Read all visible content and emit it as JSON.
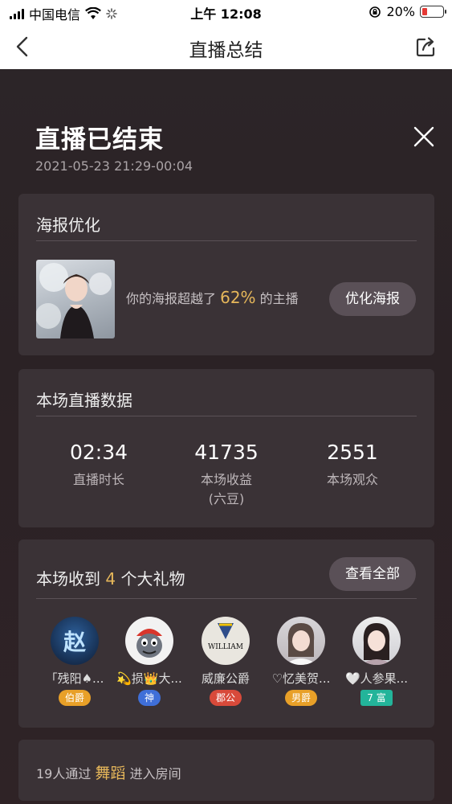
{
  "status_bar": {
    "carrier": "中国电信",
    "time": "上午 12:08",
    "battery": "20%",
    "battery_level": 0.2
  },
  "nav": {
    "title": "直播总结",
    "back_icon": "chevron-left-icon",
    "share_icon": "share-icon"
  },
  "summary": {
    "title": "直播已结束",
    "datetime": "2021-05-23 21:29-00:04"
  },
  "poster": {
    "title": "海报优化",
    "text_before": "你的海报超越了",
    "percent": "62%",
    "text_after": "的主播",
    "button": "优化海报"
  },
  "stats": {
    "title": "本场直播数据",
    "items": [
      {
        "value": "02:34",
        "label": "直播时长",
        "sub": ""
      },
      {
        "value": "41735",
        "label": "本场收益",
        "sub": "(六豆)"
      },
      {
        "value": "2551",
        "label": "本场观众",
        "sub": ""
      }
    ]
  },
  "gifts": {
    "title_before": "本场收到",
    "count": "4",
    "title_after": "个大礼物",
    "button": "查看全部",
    "users": [
      {
        "name": "「残阳♠...",
        "badge": "伯爵",
        "badge_color": "#e8a028",
        "avatar_text": "赵"
      },
      {
        "name": "💫损👑大...",
        "badge": "神",
        "badge_color": "#3f6fd8",
        "avatar_text": ""
      },
      {
        "name": "威廉公爵",
        "badge": "郡公",
        "badge_color": "#d84a3a",
        "avatar_text": "WILLIAM"
      },
      {
        "name": "♡忆美贺...",
        "badge": "男爵",
        "badge_color": "#e8a028",
        "avatar_text": ""
      },
      {
        "name": "🤍人参果...",
        "badge": "7 富",
        "badge_color": "#23b49a",
        "avatar_text": ""
      }
    ]
  },
  "entry": {
    "count_text": "19人通过",
    "source": "舞蹈",
    "after": "进入房间"
  },
  "colors": {
    "accent": "#e6b75a",
    "card": "#3a3236",
    "background": "#2a2326"
  }
}
